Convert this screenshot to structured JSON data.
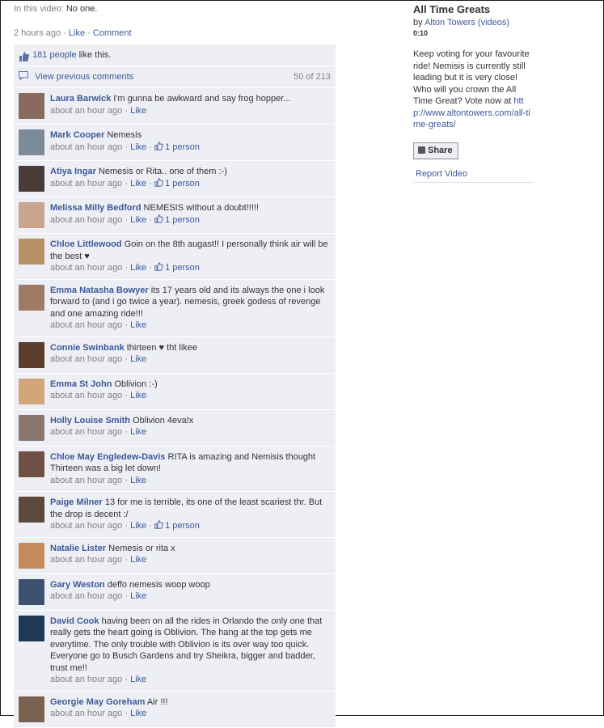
{
  "video": {
    "tagged_label": "In this video:",
    "tagged_value": "No one.",
    "time": "2 hours ago",
    "like_link": "Like",
    "comment_link": "Comment",
    "sep": "·"
  },
  "likes": {
    "count_link": "181 people",
    "suffix": " like this."
  },
  "previous": {
    "label": "View previous comments",
    "count": "50 of 213"
  },
  "comments": [
    {
      "author": "Laura Barwick",
      "text": "I'm gunna be awkward and say frog hopper...",
      "time": "about an hour ago",
      "like": "Like",
      "likes": "",
      "avatar": "#8a6a5c"
    },
    {
      "author": "Mark Cooper",
      "text": "Nemesis",
      "time": "about an hour ago",
      "like": "Like",
      "likes": "1 person",
      "avatar": "#7d8a99"
    },
    {
      "author": "Atiya Ingar",
      "text": "Nemesis or Rita.. one of them :-)",
      "time": "about an hour ago",
      "like": "Like",
      "likes": "1 person",
      "avatar": "#4a3a3a"
    },
    {
      "author": "Melissa Milly Bedford",
      "text": "NEMESIS without a doubt!!!!!",
      "time": "about an hour ago",
      "like": "Like",
      "likes": "1 person",
      "avatar": "#c9a48e"
    },
    {
      "author": "Chloe Littlewood",
      "text": "Goin on the 8th augast!! I personally think air will be the best ♥",
      "time": "about an hour ago",
      "like": "Like",
      "likes": "1 person",
      "avatar": "#b79066"
    },
    {
      "author": "Emma Natasha Bowyer",
      "text": "its 17 years old and its always the one i look forward to (and i go twice a year). nemesis, greek godess of revenge and one amazing ride!!!",
      "time": "about an hour ago",
      "like": "Like",
      "likes": "",
      "avatar": "#a07a62"
    },
    {
      "author": "Connie Swinbank",
      "text": "thirteen ♥ tht likee",
      "time": "about an hour ago",
      "like": "Like",
      "likes": "",
      "avatar": "#5a3d2a"
    },
    {
      "author": "Emma St John",
      "text": "Oblivion :-)",
      "time": "about an hour ago",
      "like": "Like",
      "likes": "",
      "avatar": "#d1a67a"
    },
    {
      "author": "Holly Louise Smith",
      "text": "Oblivion 4eva!x",
      "time": "about an hour ago",
      "like": "Like",
      "likes": "",
      "avatar": "#8b7770"
    },
    {
      "author": "Chloe May Engledew-Davis",
      "text": "RITA is amazing and Nemisis thought Thirteen was a big let down!",
      "time": "about an hour ago",
      "like": "Like",
      "likes": "",
      "avatar": "#6e4f44"
    },
    {
      "author": "Paige Milner",
      "text": "13 for me is terrible, its one of the least scariest thr. But the drop is decent :/",
      "time": "about an hour ago",
      "like": "Like",
      "likes": "1 person",
      "avatar": "#5b4a3c"
    },
    {
      "author": "Natalie Lister",
      "text": "Nemesis or rita x",
      "time": "about an hour ago",
      "like": "Like",
      "likes": "",
      "avatar": "#c48a5a"
    },
    {
      "author": "Gary Weston",
      "text": "deffo nemesis woop woop",
      "time": "about an hour ago",
      "like": "Like",
      "likes": "",
      "avatar": "#3d5270"
    },
    {
      "author": "David Cook",
      "text": "having been on all the rides in Orlando the only one that really gets the heart going is Oblivion. The hang at the top gets me everytime. The only trouble with Oblivion is its over way too quick. Everyone go to Busch Gardens and try Sheikra, bigger and badder, trust me!!",
      "time": "about an hour ago",
      "like": "Like",
      "likes": "",
      "avatar": "#1e3a55"
    },
    {
      "author": "Georgie May Goreham",
      "text": "Air !!!",
      "time": "about an hour ago",
      "like": "Like",
      "likes": "",
      "avatar": "#7a6250"
    }
  ],
  "side": {
    "title": "All Time Greats",
    "by_label": "by",
    "by_link": "Alton Towers",
    "videos_link": "(videos)",
    "duration": "0:10",
    "description": "Keep voting for your favourite ride! Nemisis is currently still leading but it is very close! Who will you crown the All Time Great? Vote now at",
    "url": "http://www.altontowers.com/all-time-greats/",
    "share_label": "Share",
    "report_label": "Report Video"
  },
  "colors": {
    "link": "#3b5998",
    "comment_bg": "#edeff4",
    "meta_grey": "#808080"
  }
}
